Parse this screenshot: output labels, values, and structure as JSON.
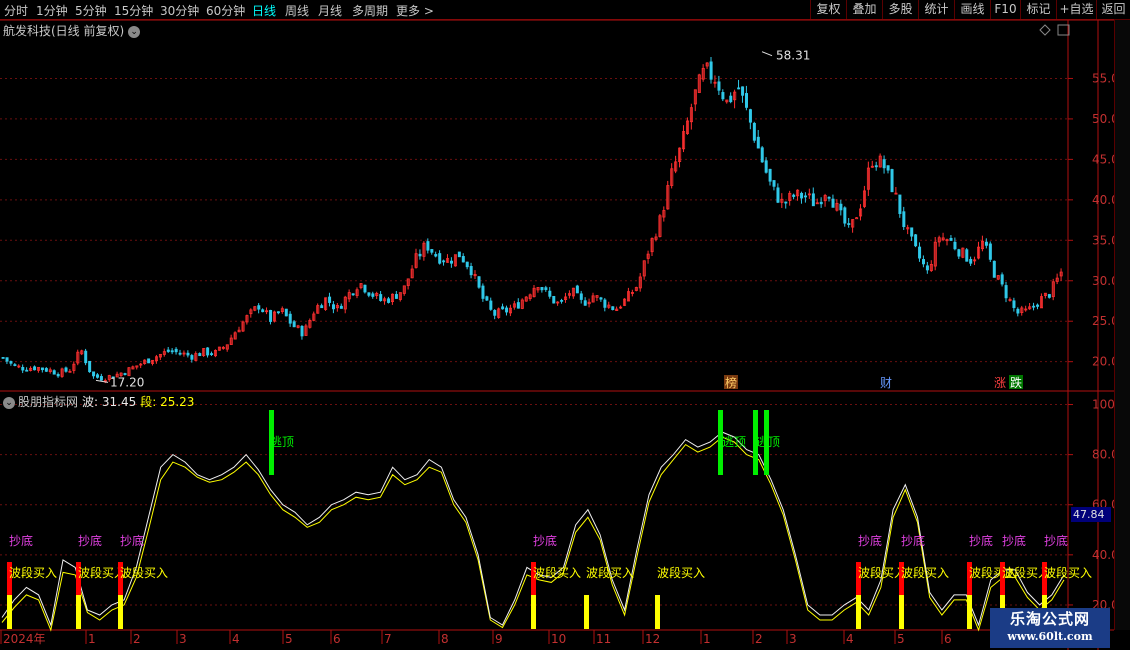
{
  "toolbar": {
    "periods": [
      {
        "label": "分时",
        "active": false
      },
      {
        "label": "1分钟",
        "active": false
      },
      {
        "label": "5分钟",
        "active": false
      },
      {
        "label": "15分钟",
        "active": false
      },
      {
        "label": "30分钟",
        "active": false
      },
      {
        "label": "60分钟",
        "active": false
      },
      {
        "label": "日线",
        "active": true
      },
      {
        "label": "周线",
        "active": false
      },
      {
        "label": "月线",
        "active": false
      },
      {
        "label": "多周期",
        "active": false
      },
      {
        "label": "更多 >",
        "active": false
      }
    ],
    "tools": [
      "复权",
      "叠加",
      "多股",
      "统计",
      "画线",
      "F10",
      "标记",
      "+自选",
      "返回"
    ]
  },
  "main_chart": {
    "title": "航发科技(日线 前复权)",
    "high_label": "58.31",
    "low_label": "17.20",
    "price_ticks": [
      "55.00",
      "50.00",
      "45.00",
      "40.00",
      "35.00",
      "30.00",
      "25.00",
      "20.00"
    ],
    "event_markers": [
      {
        "text": "榜",
        "bg": "#7a3a10",
        "color": "#ffcc66"
      },
      {
        "text": "财",
        "bg": "#000000",
        "color": "#6699ff"
      },
      {
        "text": "涨",
        "bg": "#000000",
        "color": "#ff4040"
      },
      {
        "text": "跌",
        "bg": "#007700",
        "color": "#ffffff"
      }
    ]
  },
  "indicator": {
    "name": "股朋指标网",
    "bo_label": "波: 31.45",
    "duan_label": "段: 25.23",
    "current_value": "47.84",
    "ticks": [
      "100.0",
      "80.00",
      "60.00",
      "40.00",
      "20.00"
    ],
    "label_chaodi": "抄底",
    "label_bdmr": "波段买入",
    "label_taoding": "逃顶"
  },
  "x_axis": {
    "labels": [
      "2024年",
      "1",
      "2",
      "3",
      "4",
      "5",
      "6",
      "7",
      "8",
      "9",
      "10",
      "11",
      "12",
      "1",
      "2",
      "3",
      "4",
      "5",
      "6"
    ]
  },
  "watermark": {
    "line1": "乐淘公式网",
    "line2": "www.60lt.com"
  },
  "chart_data": {
    "type": "candlestick",
    "title": "航发科技(日线 前复权)",
    "y_range": [
      16.5,
      60
    ],
    "high": 58.31,
    "low": 17.2,
    "x_labels": [
      "2024年",
      "1",
      "2",
      "3",
      "4",
      "5",
      "6",
      "7",
      "8",
      "9",
      "10",
      "11",
      "12",
      "1",
      "2",
      "3",
      "4",
      "5",
      "6"
    ],
    "close_path": [
      20.5,
      19.4,
      19.2,
      19.3,
      19.0,
      18.6,
      19.0,
      21.5,
      18.2,
      18.0,
      18.3,
      18.8,
      19.5,
      20.2,
      20.8,
      21.4,
      21.0,
      20.7,
      21.2,
      21.0,
      22.0,
      24.0,
      25.6,
      27.0,
      25.2,
      26.3,
      24.5,
      23.5,
      26.5,
      27.8,
      26.5,
      28.3,
      29.8,
      28.5,
      27.5,
      28.0,
      29.0,
      32.5,
      34.5,
      33.0,
      32.5,
      33.3,
      31.5,
      28.0,
      25.8,
      26.2,
      26.8,
      28.2,
      29.8,
      28.0,
      27.0,
      28.8,
      27.2,
      28.2,
      27.2,
      26.5,
      27.8,
      29.5,
      34.0,
      37.5,
      43.0,
      47.0,
      52.5,
      56.0,
      55.0,
      52.0,
      54.0,
      50.0,
      45.5,
      41.5,
      39.5,
      40.5,
      40.5,
      39.5,
      41.5,
      38.5,
      36.0,
      39.5,
      45.0,
      44.5,
      41.0,
      36.5,
      33.5,
      31.0,
      35.5,
      35.0,
      33.5,
      32.5,
      34.8,
      31.0,
      28.5,
      26.0,
      26.2,
      27.5,
      28.5,
      31.0
    ],
    "indicator": {
      "name": "股朋指标网",
      "bo": 31.45,
      "duan": 25.23,
      "current": 47.84,
      "y_range": [
        10,
        105
      ],
      "bo_path": [
        15,
        22,
        27,
        24,
        12,
        38,
        35,
        18,
        16,
        20,
        22,
        35,
        55,
        75,
        80,
        77,
        72,
        70,
        72,
        75,
        80,
        74,
        66,
        60,
        57,
        52,
        55,
        60,
        62,
        65,
        64,
        65,
        75,
        70,
        72,
        78,
        75,
        62,
        55,
        40,
        15,
        12,
        22,
        35,
        32,
        31,
        35,
        52,
        58,
        48,
        30,
        18,
        42,
        64,
        75,
        80,
        86,
        83,
        85,
        89,
        87,
        82,
        80,
        70,
        58,
        40,
        20,
        16,
        16,
        20,
        23,
        18,
        30,
        58,
        68,
        55,
        25,
        18,
        24,
        24,
        12,
        30,
        34,
        34,
        25,
        20,
        24,
        32
      ],
      "duan_path": [
        13,
        19,
        24,
        22,
        10,
        33,
        32,
        17,
        14,
        18,
        20,
        31,
        50,
        70,
        77,
        75,
        71,
        69,
        70,
        73,
        77,
        72,
        64,
        58,
        55,
        51,
        53,
        58,
        60,
        63,
        62,
        63,
        72,
        68,
        70,
        75,
        73,
        60,
        53,
        38,
        14,
        11,
        20,
        32,
        30,
        29,
        33,
        49,
        55,
        46,
        28,
        16,
        39,
        61,
        72,
        78,
        84,
        81,
        83,
        87,
        85,
        80,
        78,
        68,
        56,
        38,
        18,
        14,
        14,
        18,
        21,
        16,
        27,
        55,
        66,
        53,
        23,
        16,
        22,
        22,
        10,
        27,
        31,
        31,
        23,
        18,
        22,
        30
      ]
    }
  }
}
